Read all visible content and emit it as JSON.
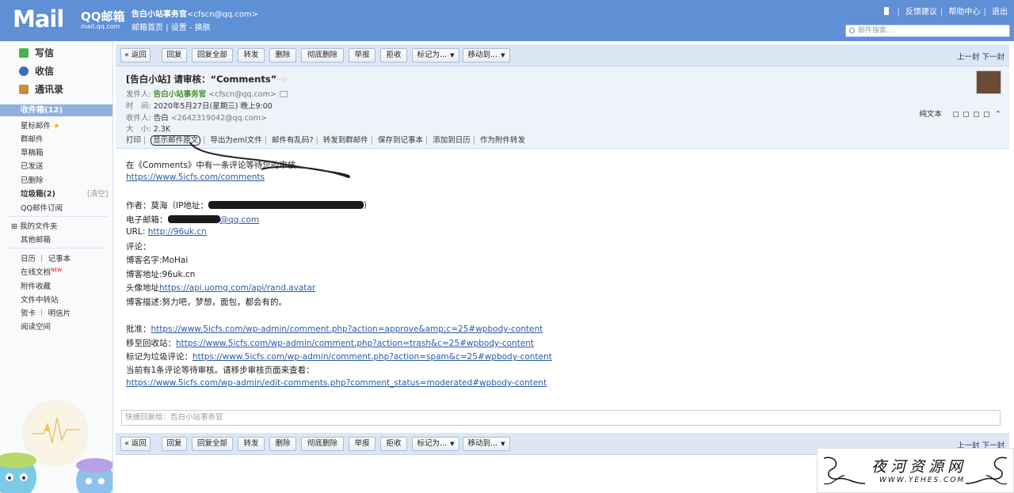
{
  "header": {
    "logo_text": "Mail",
    "logo_qq": "QQ邮箱",
    "logo_domain": "mail.qq.com",
    "user_name": "告白小站事务官",
    "user_email": "<cfscn@qq.com>",
    "user_links": [
      "邮箱首页",
      "设置",
      "换肤"
    ],
    "top_links": [
      "反馈建议",
      "帮助中心",
      "退出"
    ],
    "search_placeholder": "邮件搜索..."
  },
  "sidebar": {
    "compose": "写信",
    "inbox_main": "收信",
    "contacts": "通讯录",
    "inbox": "收件箱(12)",
    "starred": "星标邮件",
    "groups": "群邮件",
    "drafts": "草稿箱",
    "sent": "已发送",
    "deleted": "已删除",
    "spam": "垃圾箱(2)",
    "spam_clear": "[清空]",
    "subscriptions": "QQ邮件订阅",
    "my_folders": "我的文件夹",
    "other_mail": "其他邮箱",
    "calendar": "日历",
    "notes": "记事本",
    "online_docs": "在线文档",
    "new_badge": "NEW",
    "attachments": "附件收藏",
    "file_transfer": "文件中转站",
    "cards": "贺卡",
    "postcards": "明信片",
    "reading": "阅读空间"
  },
  "toolbar": {
    "back": "« 返回",
    "reply": "回复",
    "reply_all": "回复全部",
    "forward": "转发",
    "delete": "删除",
    "delete_permanent": "彻底删除",
    "report": "举报",
    "reject": "拒收",
    "mark_as": "标记为...",
    "move_to": "移动到...",
    "prev_next": "上一封 下一封"
  },
  "mail": {
    "subject": "[告白小站] 请审核：“Comments”",
    "from_label": "发件人:",
    "from_name": "告白小站事务官",
    "from_email": "<cfscn@qq.com>",
    "time_label": "时　间:",
    "time_value": "2020年5月27日(星期三) 晚上9:00",
    "to_label": "收件人:",
    "to_name": "告白",
    "to_email": "<2642319042@qq.com>",
    "size_label": "大　小:",
    "size_value": "2.3K",
    "actions": [
      "打印",
      "显示邮件原文",
      "导出为eml文件",
      "邮件有乱码?",
      "转发到群邮件",
      "保存到记事本",
      "添加到日历",
      "作为附件转发"
    ],
    "plain_text": "纯文本"
  },
  "body": {
    "l1": "在《Comments》中有一条评论等待您的审核",
    "l2": "https://www.5icfs.com/comments",
    "author_prefix": "作者：莫海（IP地址：",
    "author_suffix": "）",
    "email_prefix": "电子邮箱：",
    "email_suffix": "@qq.com",
    "url_prefix": "URL: ",
    "url_value": "http://96uk.cn",
    "comment_label": "评论：",
    "blog_name": "博客名字:MoHai",
    "blog_addr": "博客地址:96uk.cn",
    "avatar_prefix": "头像地址",
    "avatar_url": "https://api.uomg.com/api/rand.avatar",
    "blog_desc": "博客描述:努力吧，梦想，面包，都会有的。",
    "approve_prefix": "批准：",
    "approve_url": "https://www.5icfs.com/wp-admin/comment.php?action=approve&amp;c=25#wpbody-content",
    "trash_prefix": "移至回收站：",
    "trash_url": "https://www.5icfs.com/wp-admin/comment.php?action=trash&c=25#wpbody-content",
    "spam_prefix": "标记为垃圾评论：",
    "spam_url": "https://www.5icfs.com/wp-admin/comment.php?action=spam&c=25#wpbody-content",
    "pending": "当前有1条评论等待审核。请移步审核页面来查看：",
    "moderated_url": "https://www.5icfs.com/wp-admin/edit-comments.php?comment_status=moderated#wpbody-content"
  },
  "reply": {
    "placeholder": "快捷回复给：告白小站事务官"
  },
  "watermark": {
    "title": "夜河资源网",
    "url": "WWW.YEHES.COM"
  },
  "colors": {
    "header_bg": "#5f8fd5",
    "toolbar_bg": "#dbe7f5",
    "link": "#2a5aa8",
    "sender_green": "#4b8f2a"
  }
}
